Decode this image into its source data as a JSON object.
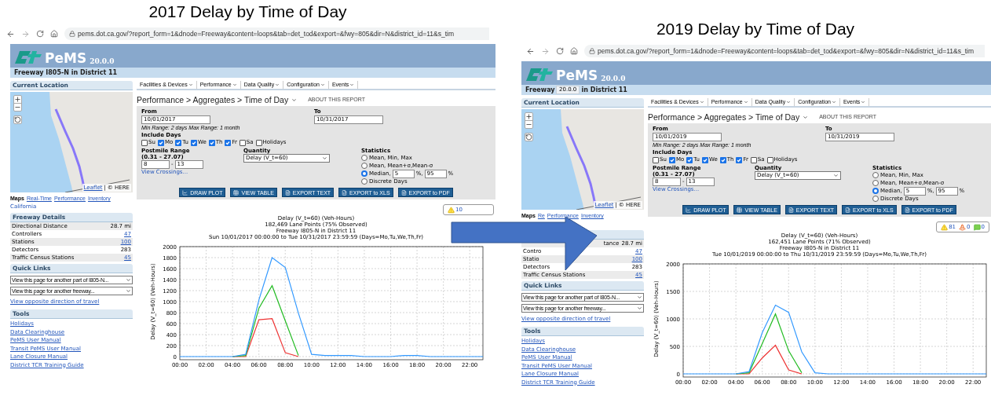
{
  "panels": [
    {
      "title": "2017 Delay by Time of Day",
      "url": "pems.dot.ca.gov/?report_form=1&dnode=Freeway&content=loops&tab=det_tod&export=&fwy=805&dir=N&district_id=11&s_tim",
      "logo": {
        "name": "PeMS",
        "version": "20.0.0"
      },
      "subheader": {
        "parts": [
          "Freeway I805-N in District 11"
        ]
      },
      "sidebar": {
        "location_title": "Current Location",
        "attribution": [
          "Leaflet",
          "|",
          "© HERE"
        ],
        "maps_label": "Maps",
        "maps_links": [
          "Real-Time",
          "Performance",
          "Inventory"
        ],
        "region": "California",
        "details_title": "Freeway Details",
        "details": [
          {
            "kind": "text",
            "label": "Directional Distance",
            "value": "28.7 mi",
            "link": false
          },
          {
            "kind": "text",
            "label": "Controllers",
            "value": "47",
            "link": true
          },
          {
            "kind": "text",
            "label": "Stations",
            "value": "100",
            "link": true
          },
          {
            "kind": "text",
            "label": "Detectors",
            "value": "283",
            "link": false
          },
          {
            "kind": "text",
            "label": "Traffic Census Stations",
            "value": "45",
            "link": true
          }
        ],
        "quick_title": "Quick Links",
        "selects": [
          "View this page for another part of I805-N...",
          "View this page for another freeway..."
        ],
        "opposite_link": "View opposite direction of travel",
        "tools_title": "Tools",
        "tools": [
          "Holidays",
          "Data Clearinghouse",
          "PeMS User Manual",
          "Transit PeMS User Manual",
          "Lane Closure Manual",
          "District TCR Training Guide"
        ]
      },
      "menu": [
        "Facilities & Devices",
        "Performance",
        "Data Quality",
        "Configuration",
        "Events"
      ],
      "breadcrumb": "Performance > Aggregates > Time of Day",
      "about": "ABOUT THIS REPORT",
      "form": {
        "from_label": "From",
        "from": "10/01/2017",
        "range_hint": "Min Range: 2 days Max Range: 1 month",
        "to_label": "To",
        "to": "10/31/2017",
        "days_label": "Include Days",
        "days": [
          {
            "label": "Su",
            "checked": false
          },
          {
            "label": "Mo",
            "checked": true
          },
          {
            "label": "Tu",
            "checked": true
          },
          {
            "label": "We",
            "checked": true
          },
          {
            "label": "Th",
            "checked": true
          },
          {
            "label": "Fr",
            "checked": true
          },
          {
            "label": "Sa",
            "checked": false
          },
          {
            "label": "Holidays",
            "checked": false
          }
        ],
        "postmile_label": "Postmile Range",
        "postmile_range": "(0.31 - 27.07)",
        "pm_from": "8",
        "pm_sep": "-",
        "pm_to": "13",
        "crossings": "View Crossings...",
        "quantity_label": "Quantity",
        "quantity": "Delay (V_t=60)",
        "stats_label": "Statistics",
        "stats": [
          {
            "label": "Mean, Min, Max",
            "selected": false
          },
          {
            "label": "Mean, Mean+σ,Mean-σ",
            "selected": false
          },
          {
            "label": "Median,",
            "selected": true,
            "low": "5",
            "low_unit": "%,",
            "high": "95",
            "high_unit": "%"
          },
          {
            "label": "Discrete Days",
            "selected": false
          }
        ],
        "buttons": [
          {
            "label": "DRAW PLOT",
            "kind": "plot"
          },
          {
            "label": "VIEW TABLE",
            "kind": "table"
          },
          {
            "label": "EXPORT TEXT",
            "kind": "text"
          },
          {
            "label": "EXPORT to XLS",
            "kind": "xls"
          },
          {
            "label": "EXPORT to PDF",
            "kind": "pdf"
          }
        ]
      },
      "badges": [
        {
          "kind": "warning",
          "count": "10"
        }
      ],
      "chart": {
        "subtitles": [
          "182,469 Lane Points (75% Observed)",
          "Freeway I805-N in District 11",
          "Sun 10/01/2017 00:00:00 to Tue 10/31/2017 23:59:59 (Days=Mo,Tu,We,Th,Fr)"
        ],
        "chart_data": {
          "type": "line",
          "title": "Delay (V_t=60) (Veh-Hours)",
          "ylabel": "Delay (V_t=60) (Veh-Hours)",
          "x": [
            0,
            1,
            2,
            3,
            4,
            5,
            6,
            7,
            8,
            9,
            10,
            11,
            12,
            13,
            14,
            15,
            16,
            17,
            18,
            19,
            20,
            21,
            22,
            23
          ],
          "xlim": [
            0,
            23
          ],
          "ylim": [
            0,
            2000
          ],
          "xticks": [
            {
              "value": 0,
              "label": "00:00"
            },
            {
              "value": 2,
              "label": "02:00"
            },
            {
              "value": 4,
              "label": "04:00"
            },
            {
              "value": 6,
              "label": "06:00"
            },
            {
              "value": 8,
              "label": "08:00"
            },
            {
              "value": 10,
              "label": "10:00"
            },
            {
              "value": 12,
              "label": "12:00"
            },
            {
              "value": 14,
              "label": "14:00"
            },
            {
              "value": 16,
              "label": "16:00"
            },
            {
              "value": 18,
              "label": "18:00"
            },
            {
              "value": 20,
              "label": "20:00"
            },
            {
              "value": 22,
              "label": "22:00"
            }
          ],
          "yticks": [
            0,
            200,
            400,
            600,
            800,
            1000,
            1200,
            1400,
            1600,
            1800,
            2000
          ],
          "series": [
            {
              "color": "#3399ff",
              "values": [
                0,
                0,
                0,
                0,
                0,
                40,
                1030,
                1800,
                1620,
                790,
                40,
                20,
                20,
                20,
                0,
                0,
                0,
                20,
                20,
                0,
                0,
                0,
                0,
                0
              ]
            },
            {
              "color": "#22bb22",
              "values": [
                null,
                null,
                null,
                null,
                0,
                20,
                880,
                1290,
                650,
                20,
                null,
                null,
                null,
                null,
                null,
                null,
                null,
                null,
                null,
                null,
                null,
                null,
                null,
                null
              ]
            },
            {
              "color": "#ee3333",
              "values": [
                null,
                null,
                null,
                null,
                0,
                0,
                670,
                690,
                70,
                0,
                null,
                null,
                null,
                null,
                null,
                null,
                null,
                null,
                null,
                null,
                null,
                null,
                null,
                null
              ]
            }
          ],
          "grid": true
        }
      }
    },
    {
      "title": "2019 Delay by Time of Day",
      "url": "pems.dot.ca.gov/?report_form=1&dnode=Freeway&content=loops&tab=det_tod&export=&fwy=805&dir=N&district_id=11&s_tim",
      "logo": {
        "name": "PeMS",
        "version": "20.0.0"
      },
      "subheader": {
        "parts": [
          "Freeway",
          "in District 11"
        ],
        "tooltip": "20.0.0"
      },
      "sidebar": {
        "location_title": "Current Location",
        "attribution": [
          "Leaflet",
          "|",
          "© HERE"
        ],
        "maps_label": "Maps",
        "maps_links": [
          "Re",
          "Performance",
          "Inventory"
        ],
        "details": [
          {
            "kind": "tail",
            "label": "tance",
            "value": "28.7 mi",
            "link": false
          },
          {
            "kind": "text",
            "label": "Contro",
            "value": "47",
            "link": true
          },
          {
            "kind": "text",
            "label": "Statio",
            "value": "100",
            "link": true
          },
          {
            "kind": "text",
            "label": "Detectors",
            "value": "283",
            "link": false
          },
          {
            "kind": "text",
            "label": "Traffic Census Stations",
            "value": "45",
            "link": true
          }
        ],
        "quick_title": "Quick Links",
        "selects": [
          "View this page for another part of I805-N...",
          "View this page for another freeway..."
        ],
        "opposite_link": "View opposite direction of travel",
        "tools_title": "Tools",
        "tools": [
          "Holidays",
          "Data Clearinghouse",
          "PeMS User Manual",
          "Transit PeMS User Manual",
          "Lane Closure Manual",
          "District TCR Training Guide"
        ]
      },
      "menu": [
        "Facilities & Devices",
        "Performance",
        "Data Quality",
        "Configuration",
        "Events"
      ],
      "breadcrumb": "Performance > Aggregates > Time of Day",
      "about": "ABOUT THIS REPORT",
      "form": {
        "from_label": "From",
        "from": "10/01/2019",
        "range_hint": "Min Range: 2 days Max Range: 1 month",
        "to_label": "To",
        "to": "10/31/2019",
        "days_label": "Include Days",
        "days": [
          {
            "label": "Su",
            "checked": false
          },
          {
            "label": "Mo",
            "checked": true
          },
          {
            "label": "Tu",
            "checked": true
          },
          {
            "label": "We",
            "checked": true
          },
          {
            "label": "Th",
            "checked": true
          },
          {
            "label": "Fr",
            "checked": true
          },
          {
            "label": "Sa",
            "checked": false
          },
          {
            "label": "Holidays",
            "checked": false
          }
        ],
        "postmile_label": "Postmile Range",
        "postmile_range": "(0.31 - 27.07)",
        "pm_from": "8",
        "pm_sep": "-",
        "pm_to": "13",
        "crossings": "View Crossings...",
        "quantity_label": "Quantity",
        "quantity": "Delay (V_t=60)",
        "stats_label": "Statistics",
        "stats": [
          {
            "label": "Mean, Min, Max",
            "selected": false
          },
          {
            "label": "Mean, Mean+σ,Mean-σ",
            "selected": false
          },
          {
            "label": "Median,",
            "selected": true,
            "low": "5",
            "low_unit": "%,",
            "high": "95",
            "high_unit": "%"
          },
          {
            "label": "Discrete Days",
            "selected": false
          }
        ],
        "buttons": [
          {
            "label": "DRAW PLOT",
            "kind": "plot"
          },
          {
            "label": "VIEW TABLE",
            "kind": "table"
          },
          {
            "label": "EXPORT TEXT",
            "kind": "text"
          },
          {
            "label": "EXPORT to XLS",
            "kind": "xls"
          },
          {
            "label": "EXPORT to PDF",
            "kind": "pdf"
          }
        ]
      },
      "badges": [
        {
          "kind": "warning",
          "count": "81"
        },
        {
          "kind": "cone",
          "count": "0"
        },
        {
          "kind": "chat",
          "count": "0"
        }
      ],
      "chart": {
        "subtitles": [
          "162,451 Lane Points (71% Observed)",
          "Freeway I805-N in District 11",
          "Tue 10/01/2019 00:00:00 to Thu 10/31/2019 23:59:59 (Days=Mo,Tu,We,Th,Fr)"
        ],
        "chart_data": {
          "type": "line",
          "title": "Delay (V_t=60) (Veh-Hours)",
          "ylabel": "Delay (V_t=60) (Veh-Hours)",
          "x": [
            0,
            1,
            2,
            3,
            4,
            5,
            6,
            7,
            8,
            9,
            10,
            11,
            12,
            13,
            14,
            15,
            16,
            17,
            18,
            19,
            20,
            21,
            22,
            23
          ],
          "xlim": [
            0,
            23
          ],
          "ylim": [
            0,
            2000
          ],
          "xticks": [
            {
              "value": 0,
              "label": "00:00"
            },
            {
              "value": 2,
              "label": "02:00"
            },
            {
              "value": 4,
              "label": "04:00"
            },
            {
              "value": 6,
              "label": "06:00"
            },
            {
              "value": 8,
              "label": "08:00"
            },
            {
              "value": 10,
              "label": "10:00"
            },
            {
              "value": 12,
              "label": "12:00"
            },
            {
              "value": 14,
              "label": "14:00"
            },
            {
              "value": 16,
              "label": "16:00"
            },
            {
              "value": 18,
              "label": "18:00"
            },
            {
              "value": 20,
              "label": "20:00"
            },
            {
              "value": 22,
              "label": "22:00"
            }
          ],
          "yticks": [
            0,
            500,
            1000,
            1500,
            2000
          ],
          "series": [
            {
              "color": "#3399ff",
              "values": [
                0,
                0,
                0,
                0,
                0,
                40,
                750,
                1250,
                1120,
                400,
                20,
                0,
                0,
                0,
                0,
                0,
                0,
                0,
                0,
                0,
                0,
                0,
                0,
                0
              ]
            },
            {
              "color": "#22bb22",
              "values": [
                null,
                null,
                null,
                null,
                0,
                20,
                550,
                1090,
                420,
                20,
                null,
                null,
                null,
                null,
                null,
                null,
                null,
                null,
                null,
                null,
                null,
                null,
                null,
                null
              ]
            },
            {
              "color": "#ee3333",
              "values": [
                null,
                null,
                null,
                null,
                0,
                0,
                290,
                520,
                70,
                0,
                null,
                null,
                null,
                null,
                null,
                null,
                null,
                null,
                null,
                null,
                null,
                null,
                null,
                null
              ]
            }
          ],
          "grid": true
        }
      }
    }
  ]
}
